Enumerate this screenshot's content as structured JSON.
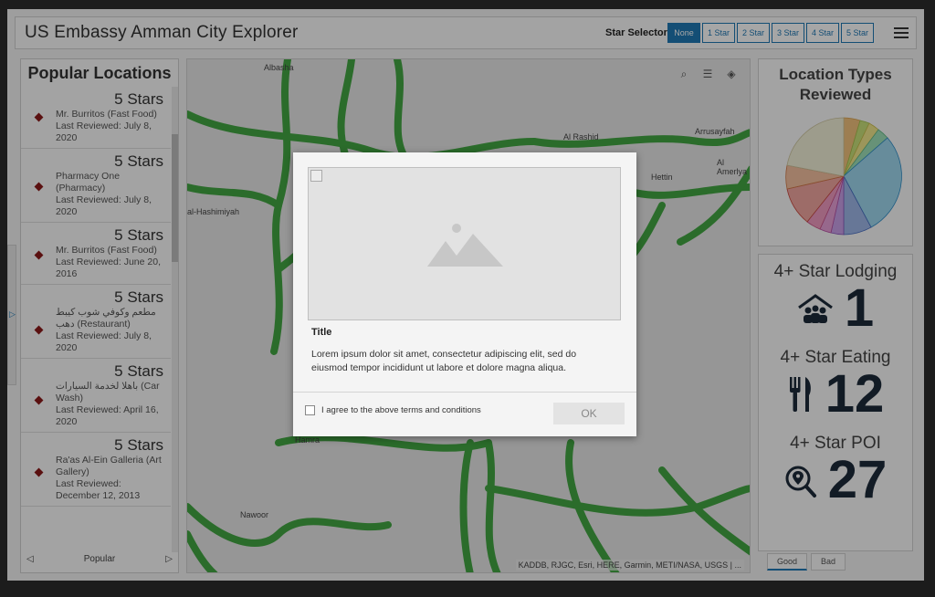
{
  "header": {
    "title": "US Embassy Amman City Explorer",
    "star_selector_label": "Star Selector",
    "star_buttons": [
      "None",
      "1 Star",
      "2 Star",
      "3 Star",
      "4 Star",
      "5 Star"
    ]
  },
  "left_panel": {
    "title": "Popular Locations",
    "items": [
      {
        "stars": "5 Stars",
        "name": "Mr. Burritos (Fast Food)",
        "reviewed": "Last Reviewed: July 8, 2020"
      },
      {
        "stars": "5 Stars",
        "name": "Pharmacy One (Pharmacy)",
        "reviewed": "Last Reviewed: July 8, 2020"
      },
      {
        "stars": "5 Stars",
        "name": "Mr. Burritos (Fast Food)",
        "reviewed": "Last Reviewed: June 20, 2016"
      },
      {
        "stars": "5 Stars",
        "name": "مطعم وكوفي شوب كيبط دهب (Restaurant)",
        "reviewed": "Last Reviewed: July 8, 2020"
      },
      {
        "stars": "5 Stars",
        "name": "باهلا لخدمة السيارات (Car Wash)",
        "reviewed": "Last Reviewed: April 16, 2020"
      },
      {
        "stars": "5 Stars",
        "name": "Ra'as Al-Ein Galleria (Art Gallery)",
        "reviewed": "Last Reviewed: December 12, 2013"
      }
    ],
    "pager_label": "Popular"
  },
  "map": {
    "labels": [
      "Albasha",
      "Al Rashid",
      "Arrusayfah",
      "Al Amerlya",
      "Hettin",
      "al-Hashimiyah",
      "Hamra",
      "Nawoor"
    ],
    "attribution": "KADDB, RJGC, Esri, HERE, Garmin, METI/NASA, USGS | ..."
  },
  "right_panel": {
    "pie_title": "Location Types Reviewed",
    "stats": [
      {
        "title": "4+ Star Lodging",
        "value": "1",
        "icon": "lodging-icon"
      },
      {
        "title": "4+ Star Eating",
        "value": "12",
        "icon": "utensils-icon"
      },
      {
        "title": "4+ Star POI",
        "value": "27",
        "icon": "poi-search-icon"
      }
    ],
    "tabs": [
      "Good",
      "Bad"
    ]
  },
  "modal": {
    "title": "Title",
    "body": "Lorem ipsum dolor sit amet, consectetur adipiscing elit, sed do eiusmod tempor incididunt ut labore et dolore magna aliqua.",
    "agree_label": "I agree to the above terms and conditions",
    "ok_label": "OK"
  },
  "colors": {
    "accent": "#1f78b4",
    "road": "#3aa43a",
    "diamond": "#8b1a1a"
  }
}
